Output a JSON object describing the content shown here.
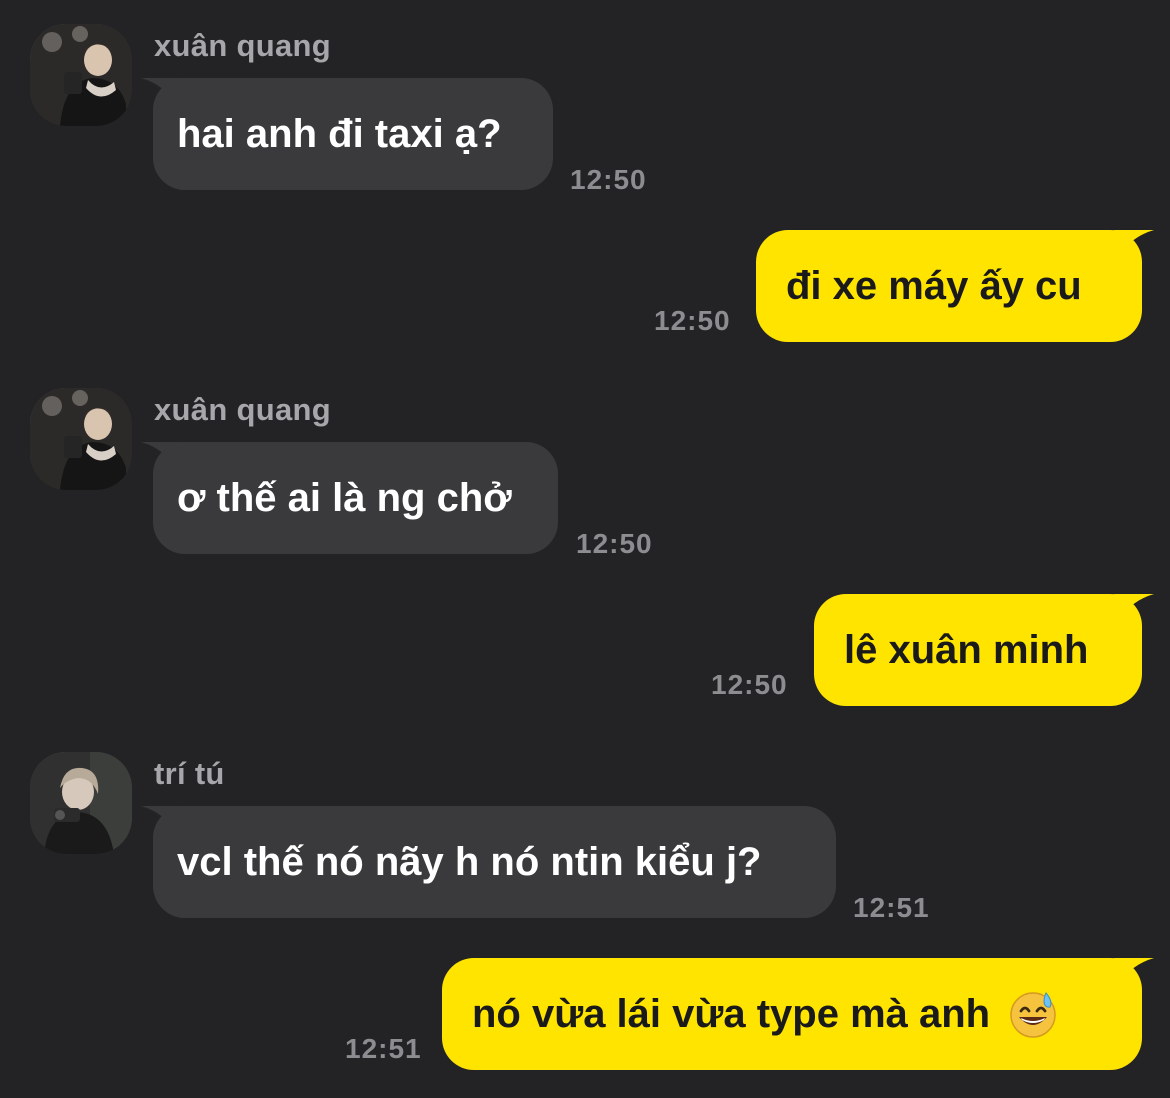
{
  "messages": [
    {
      "type": "incoming",
      "sender": "xuân quang",
      "text": "hai anh đi taxi ạ?",
      "time": "12:50",
      "avatar": "avatar-xuan-quang"
    },
    {
      "type": "outgoing",
      "text": "đi xe máy ấy cu",
      "time": "12:50"
    },
    {
      "type": "incoming",
      "sender": "xuân quang",
      "text": "ơ thế ai là ng chở",
      "time": "12:50",
      "avatar": "avatar-xuan-quang"
    },
    {
      "type": "outgoing",
      "text": "lê xuân minh",
      "time": "12:50"
    },
    {
      "type": "incoming",
      "sender": "trí tú",
      "text": "vcl thế nó nãy h nó ntin kiểu j?",
      "time": "12:51",
      "avatar": "avatar-tri-tu"
    },
    {
      "type": "outgoing",
      "text": "nó vừa lái vừa type mà anh",
      "emoji": "grinning-face-with-sweat-icon",
      "time": "12:51"
    }
  ],
  "colors": {
    "background": "#232325",
    "incoming_bubble": "#3a3a3d",
    "outgoing_bubble": "#ffe400",
    "timestamp": "#8d8d91",
    "sender_name": "#a7a7ab"
  }
}
